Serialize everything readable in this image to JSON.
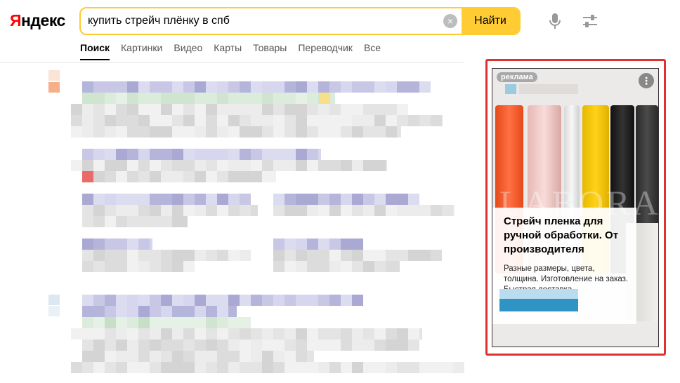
{
  "logo": {
    "first_letter": "Я",
    "rest": "ндекс"
  },
  "search": {
    "query": "купить стрейч плёнку в спб",
    "find_label": "Найти",
    "clear_glyph": "×"
  },
  "tabs": [
    {
      "label": "Поиск",
      "active": true
    },
    {
      "label": "Картинки"
    },
    {
      "label": "Видео"
    },
    {
      "label": "Карты"
    },
    {
      "label": "Товары"
    },
    {
      "label": "Переводчик"
    },
    {
      "label": "Все"
    }
  ],
  "icons": {
    "mic": "microphone-icon",
    "settings": "sliders-icon",
    "ad_menu": "more-vertical-icon"
  },
  "ad": {
    "badge": "реклама",
    "menu_glyph": "⋮",
    "watermark": "LABORA",
    "title": "Стрейч пленка для ручной обработки. От производителя",
    "description": "Разные размеры, цвета, толщина. Изготовление на заказ. Быстрая доставка."
  },
  "colors": {
    "accent": "#ffcc33",
    "highlight_border": "#e03131",
    "cta": "#2f94c4"
  }
}
